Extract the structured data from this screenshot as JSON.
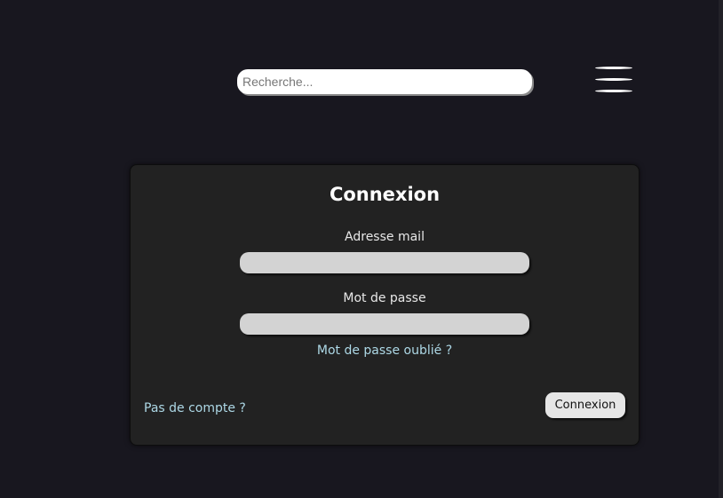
{
  "header": {
    "search": {
      "placeholder": "Recherche...",
      "value": ""
    },
    "menu_icon": "hamburger-menu-icon"
  },
  "login": {
    "title": "Connexion",
    "email_label": "Adresse mail",
    "email_value": "",
    "password_label": "Mot de passe",
    "password_value": "",
    "forgot_link": "Mot de passe oublié ?",
    "signup_link": "Pas de compte ?",
    "submit_label": "Connexion"
  },
  "colors": {
    "page_background": "#18171f",
    "card_background": "#222222",
    "input_background": "#d3d3d3",
    "link": "#add8e6",
    "button_background": "#e6e6e6"
  }
}
